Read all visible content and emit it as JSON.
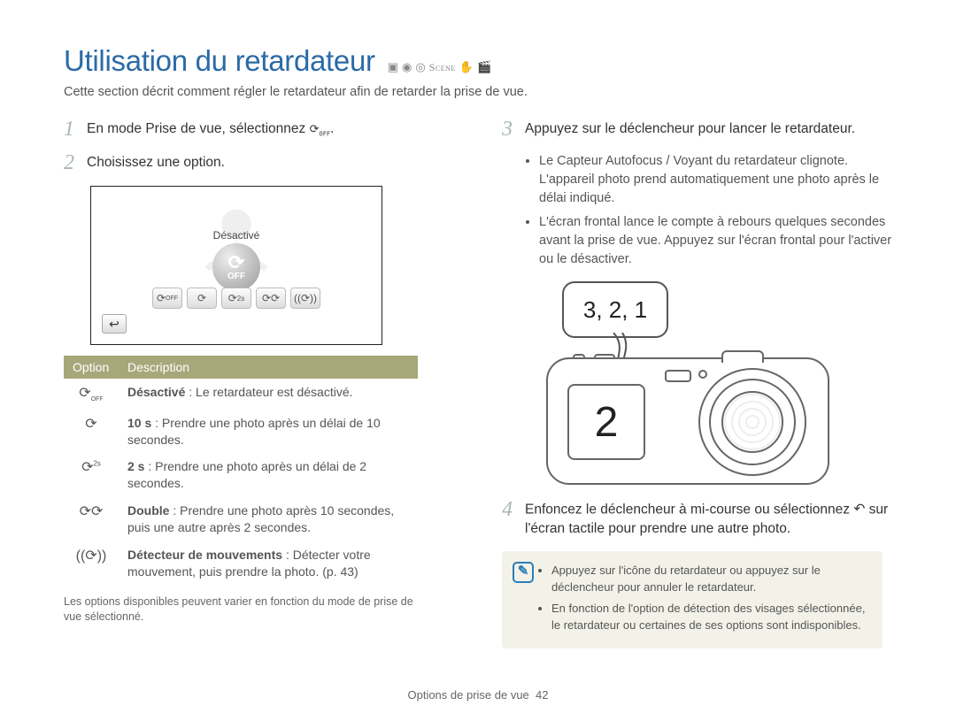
{
  "title": "Utilisation du retardateur",
  "mode_icons": [
    "camera-smart",
    "camera-auto",
    "camera-program",
    "scene",
    "dual",
    "movie"
  ],
  "scene_label": "Scene",
  "intro": "Cette section décrit comment régler le retardateur afin de retarder la prise de vue.",
  "left": {
    "step1_num": "1",
    "step1_text": "En mode Prise de vue, sélectionnez ",
    "step1_icon_label": "timer-off-icon",
    "step2_num": "2",
    "step2_text": "Choisissez une option.",
    "screen": {
      "label": "Désactivé",
      "big_off_line1": "⟳",
      "big_off_line2": "OFF",
      "options": [
        "OFF",
        "10",
        "2s",
        "⧀⧀",
        "((⟳))"
      ],
      "back": "↩"
    },
    "table_header_option": "Option",
    "table_header_desc": "Description",
    "rows": [
      {
        "icon": "⟳",
        "icon_sub": "OFF",
        "bold": "Désactivé",
        "rest": " : Le retardateur est désactivé."
      },
      {
        "icon": "⟳",
        "icon_sub": "",
        "bold": "10 s",
        "rest": " : Prendre une photo après un délai de 10 secondes."
      },
      {
        "icon": "⟳",
        "icon_sub": "2s",
        "bold": "2 s",
        "rest": " : Prendre une photo après un délai de 2 secondes."
      },
      {
        "icon": "⟳⟳",
        "icon_sub": "",
        "bold": "Double",
        "rest": " : Prendre une photo après 10 secondes, puis une autre après 2 secondes."
      },
      {
        "icon": "((⟳))",
        "icon_sub": "",
        "bold": "Détecteur de mouvements",
        "rest": " : Détecter votre mouvement, puis prendre la photo. (p. 43)"
      }
    ],
    "footnote": "Les options disponibles peuvent varier en fonction du mode de prise de vue sélectionné."
  },
  "right": {
    "step3_num": "3",
    "step3_text": "Appuyez sur le déclencheur pour lancer le retardateur.",
    "bullets3": [
      "Le Capteur Autofocus / Voyant du retardateur clignote. L'appareil photo prend automatiquement une photo après le délai indiqué.",
      "L'écran frontal lance le compte à rebours quelques secondes avant la prise de vue. Appuyez sur l'écran frontal pour l'activer ou le désactiver."
    ],
    "bubble": "3, 2, 1",
    "front_lcd": "2",
    "step4_num": "4",
    "step4_text_a": "Enfoncez le déclencheur à mi-course ou sélectionnez ",
    "step4_icon_label": "undo-icon",
    "step4_text_b": " sur l'écran tactile pour prendre une autre photo.",
    "note_icon": "✎",
    "notes": [
      "Appuyez sur l'icône du retardateur ou appuyez sur le déclencheur pour annuler le retardateur.",
      "En fonction de l'option de détection des visages sélectionnée, le retardateur ou certaines de ses options sont indisponibles."
    ]
  },
  "footer_section": "Options de prise de vue",
  "footer_page": "42"
}
